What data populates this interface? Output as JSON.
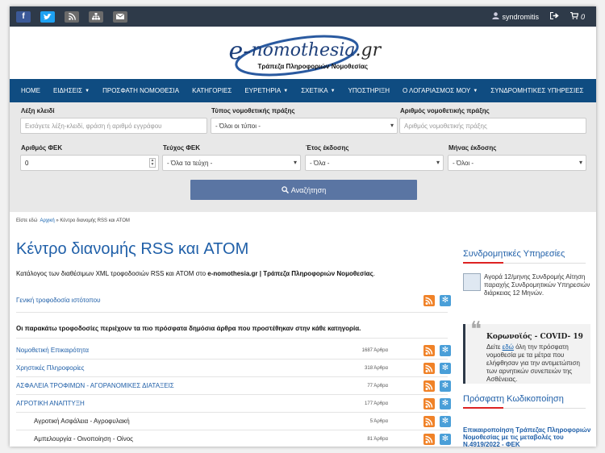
{
  "topbar": {
    "social": [
      "facebook-icon",
      "twitter-icon",
      "rss-icon",
      "sitemap-icon",
      "email-icon"
    ],
    "username": "syndromitis",
    "cart_count": "0"
  },
  "logo": {
    "brand_prefix": "e-",
    "brand_main": "nomothesia",
    "brand_suffix": ".gr",
    "tagline": "Τράπεζα Πληροφοριών Νομοθεσίας"
  },
  "nav": [
    {
      "label": "HOME",
      "caret": false
    },
    {
      "label": "ΕΙΔΗΣΕΙΣ",
      "caret": true
    },
    {
      "label": "ΠΡΟΣΦΑΤΗ ΝΟΜΟΘΕΣΙΑ",
      "caret": false
    },
    {
      "label": "ΚΑΤΗΓΟΡΙΕΣ",
      "caret": false
    },
    {
      "label": "ΕΥΡΕΤΗΡΙΑ",
      "caret": true
    },
    {
      "label": "ΣΧΕΤΙΚΑ",
      "caret": true
    },
    {
      "label": "ΥΠΟΣΤΗΡΙΞΗ",
      "caret": false
    },
    {
      "label": "Ο ΛΟΓΑΡΙΑΣΜΟΣ ΜΟΥ",
      "caret": true
    },
    {
      "label": "ΣΥΝΔΡΟΜΗΤΙΚΕΣ ΥΠΗΡΕΣΙΕΣ",
      "caret": false
    }
  ],
  "search": {
    "keyword_label": "Λέξη κλειδί",
    "keyword_placeholder": "Εισάγετε λέξη-κλειδί, φράση ή αριθμό εγγράφου",
    "type_label": "Τύπος νομοθετικής πράξης",
    "type_value": "- Όλοι οι τύποι -",
    "number_label": "Αριθμός νομοθετικής πράξης",
    "number_placeholder": "Αριθμός νομοθετικής πράξης",
    "fek_label": "Αριθμός ΦΕΚ",
    "fek_value": "0",
    "issue_label": "Τεύχος ΦΕΚ",
    "issue_value": "- Όλα τα τεύχη -",
    "year_label": "Έτος έκδοσης",
    "year_value": "- Όλα -",
    "month_label": "Μήνας έκδοσης",
    "month_value": "- Όλοι -",
    "button_label": "Αναζήτηση"
  },
  "breadcrumb": {
    "prefix": "Είστε εδώ",
    "home": "Αρχική",
    "sep": "»",
    "current": "Κέντρο διανομής RSS και ATOM"
  },
  "main": {
    "title": "Κέντρο διανομής RSS και ATOM",
    "desc_start": "Κατάλογος των διαθέσιμων XML τροφοδοσιών RSS και ATOM στο ",
    "desc_bold": "e-nomothesia.gr | Τράπεζα Πληροφοριών Νομοθεσίας",
    "desc_end": ".",
    "general_feed": "Γενική τροφοδοσία ιστότοπου",
    "note": "Οι παρακάτω τροφοδοσίες περιέχουν τα πιο πρόσφατα δημόσια άρθρα που προστέθηκαν στην κάθε κατηγορία.",
    "feeds": [
      {
        "title": "Νομοθετική Επικαιρότητα",
        "count": "1687 Άρθρα",
        "sub": false
      },
      {
        "title": "Χρηστικές Πληροφορίες",
        "count": "318 Άρθρα",
        "sub": false
      },
      {
        "title": "ΑΣΦΑΛΕΙΑ ΤΡΟΦΙΜΩΝ - ΑΓΟΡΑΝΟΜΙΚΕΣ ΔΙΑΤΑΞΕΙΣ",
        "count": "77 Άρθρα",
        "sub": false
      },
      {
        "title": "ΑΓΡΟΤΙΚΗ ΑΝΑΠΤΥΞΗ",
        "count": "177 Άρθρα",
        "sub": false
      },
      {
        "title": "Αγροτική Ασφάλεια - Αγροφυλακή",
        "count": "5 Άρθρα",
        "sub": true
      },
      {
        "title": "Αμπελουργία - Οινοποίηση - Οίνος",
        "count": "81 Άρθρα",
        "sub": true
      }
    ]
  },
  "sidebar": {
    "subs_title": "Συνδρομητικές Υπηρεσίες",
    "subs_text": "Αγορά 12/μηνης Συνδρομής Αίτηση παραχής Συνδρομητικών Υπηρεσιών διάρκειας 12 Μηνών.",
    "covid_title": "Κορωνοϊός - COVID- 19",
    "covid_pre": "Δείτε ",
    "covid_link": "εδώ",
    "covid_post": " όλη την πρόσφατη νομοθεσία με τα μέτρα που ελήφθησαν για την αντιμετώπιση των αρνητικών συνεπειών της Ασθένειας.",
    "codif_title": "Πρόσφατη Κωδικοποίηση",
    "codif_text": "Επικαιροποίηση Τράπεζας Πληροφοριών Νομοθεσίας με τις μεταβολές του Ν.4919/2022 - ΦΕΚ"
  },
  "colors": {
    "nav": "#0f4c81",
    "topbar": "#2e3a49",
    "rss": "#f08228",
    "atom": "#4a9fd8",
    "link": "#1f5fa8"
  }
}
